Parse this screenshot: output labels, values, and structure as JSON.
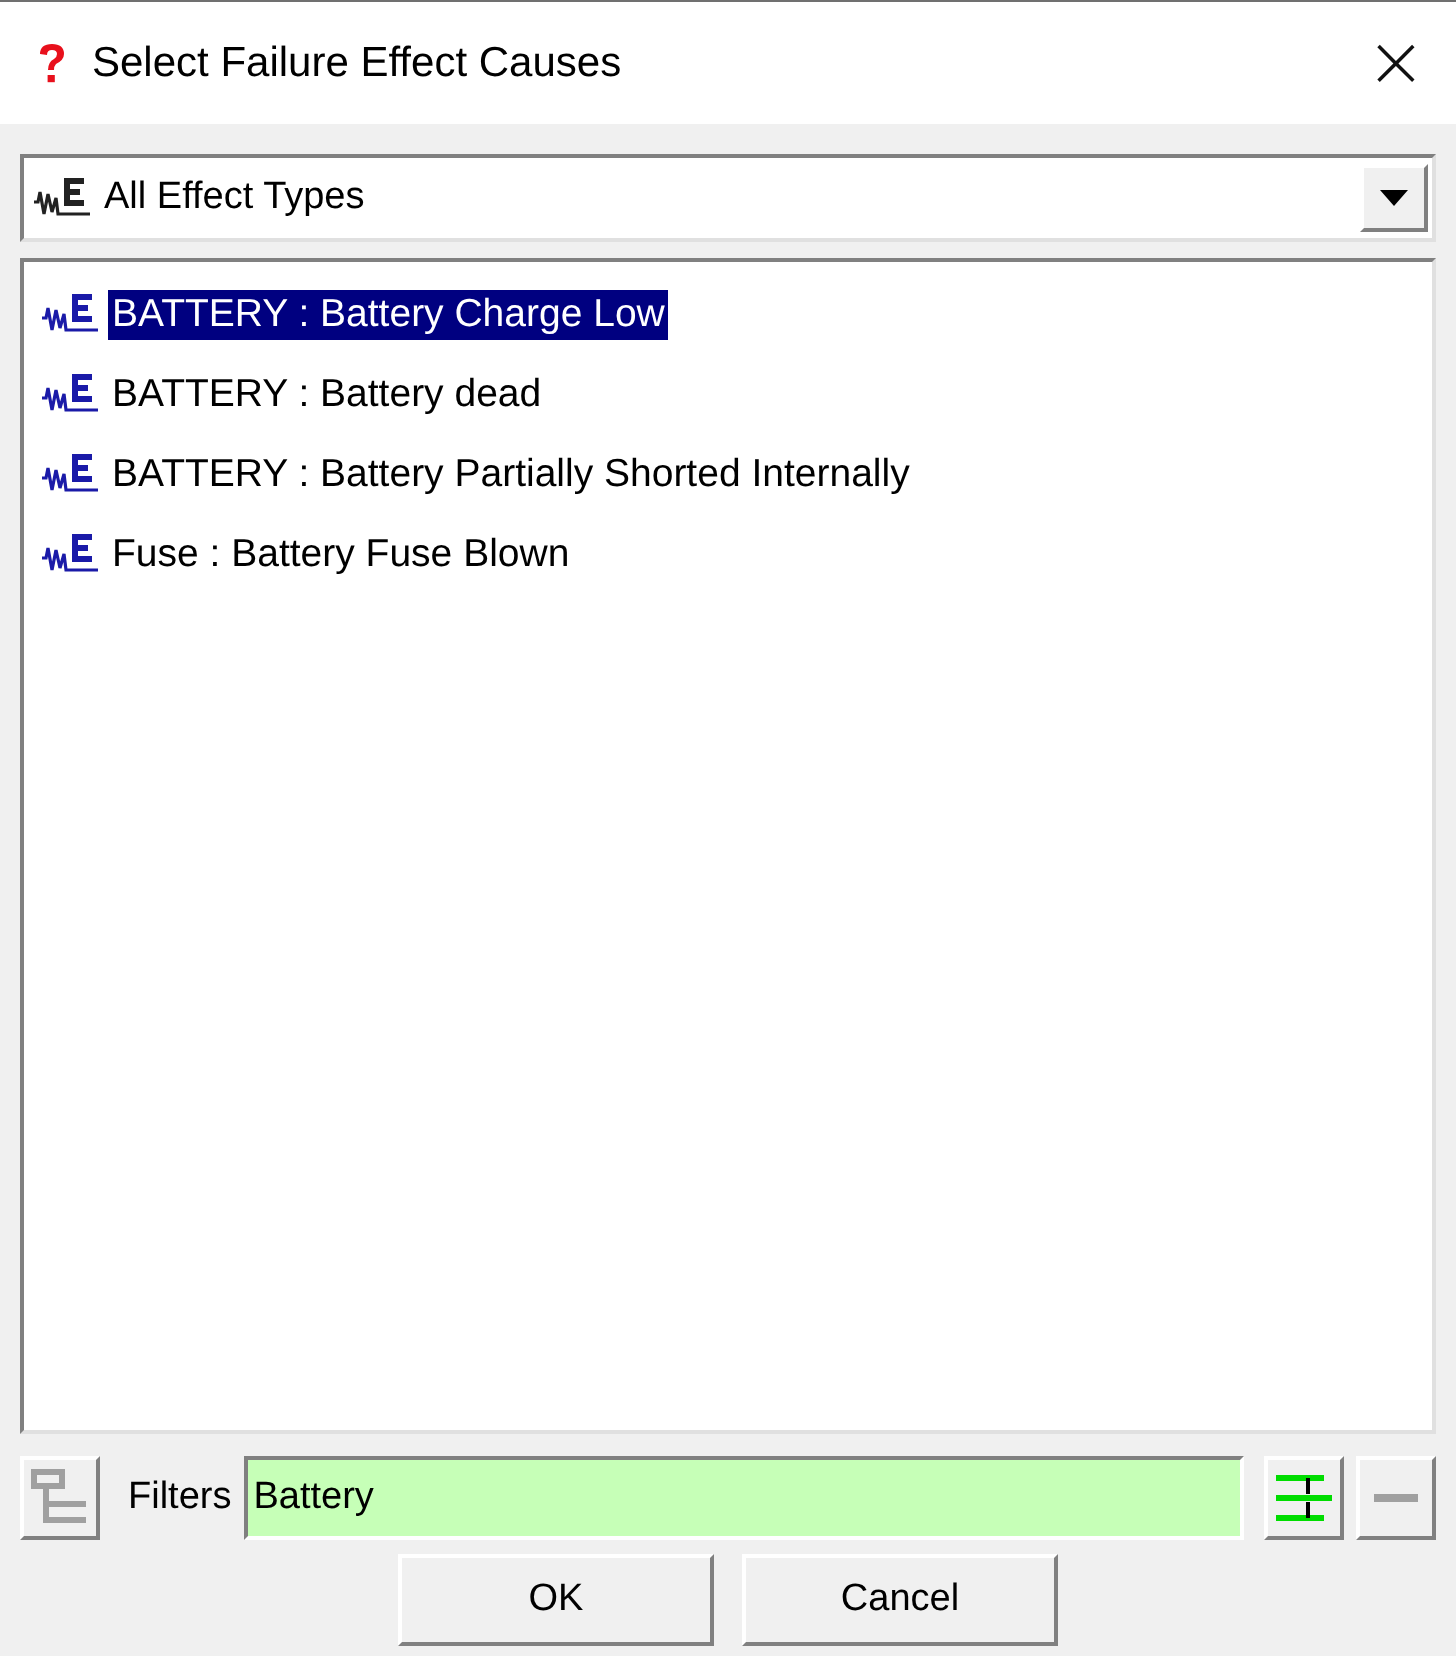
{
  "window": {
    "title": "Select Failure Effect Causes",
    "close": "×"
  },
  "type_filter": {
    "value": "All Effect Types"
  },
  "items": [
    {
      "label": "BATTERY : Battery Charge Low",
      "selected": true
    },
    {
      "label": "BATTERY : Battery dead",
      "selected": false
    },
    {
      "label": "BATTERY : Battery Partially Shorted Internally",
      "selected": false
    },
    {
      "label": "Fuse : Battery Fuse Blown",
      "selected": false
    }
  ],
  "filter": {
    "label": "Filters",
    "value": "Battery"
  },
  "buttons": [
    "OK",
    "Cancel"
  ]
}
